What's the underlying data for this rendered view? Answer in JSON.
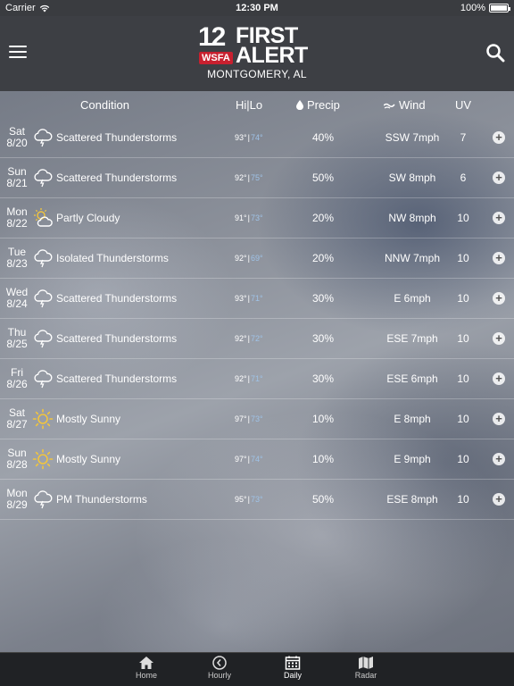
{
  "status_bar": {
    "carrier": "Carrier",
    "time": "12:30 PM",
    "battery": "100%",
    "battery_level": 1.0
  },
  "header": {
    "logo_number": "12",
    "logo_station": "WSFA",
    "logo_line1": "FIRST",
    "logo_line2": "ALERT",
    "location": "MONTGOMERY, AL",
    "menu_icon": "hamburger-menu-icon",
    "search_icon": "search-icon"
  },
  "columns": {
    "condition": "Condition",
    "hilo": "Hi|Lo",
    "precip": "Precip",
    "wind": "Wind",
    "uv": "UV"
  },
  "colors": {
    "lo_temp": "#9fc3e8",
    "sun": "#f2c53d",
    "header_bg": "#3d3f44",
    "tabbar_bg": "#202225"
  },
  "forecast": [
    {
      "dow": "Sat",
      "date": "8/20",
      "icon": "thunderstorm-icon",
      "condition": "Scattered Thunderstorms",
      "hi": "93°",
      "lo": "74°",
      "precip": "40%",
      "wind": "SSW 7mph",
      "uv": "7"
    },
    {
      "dow": "Sun",
      "date": "8/21",
      "icon": "thunderstorm-icon",
      "condition": "Scattered Thunderstorms",
      "hi": "92°",
      "lo": "75°",
      "precip": "50%",
      "wind": "SW 8mph",
      "uv": "6"
    },
    {
      "dow": "Mon",
      "date": "8/22",
      "icon": "partly-cloudy-icon",
      "condition": "Partly Cloudy",
      "hi": "91°",
      "lo": "73°",
      "precip": "20%",
      "wind": "NW 8mph",
      "uv": "10"
    },
    {
      "dow": "Tue",
      "date": "8/23",
      "icon": "thunderstorm-icon",
      "condition": "Isolated Thunderstorms",
      "hi": "92°",
      "lo": "69°",
      "precip": "20%",
      "wind": "NNW 7mph",
      "uv": "10"
    },
    {
      "dow": "Wed",
      "date": "8/24",
      "icon": "thunderstorm-icon",
      "condition": "Scattered Thunderstorms",
      "hi": "93°",
      "lo": "71°",
      "precip": "30%",
      "wind": "E 6mph",
      "uv": "10"
    },
    {
      "dow": "Thu",
      "date": "8/25",
      "icon": "thunderstorm-icon",
      "condition": "Scattered Thunderstorms",
      "hi": "92°",
      "lo": "72°",
      "precip": "30%",
      "wind": "ESE 7mph",
      "uv": "10"
    },
    {
      "dow": "Fri",
      "date": "8/26",
      "icon": "thunderstorm-icon",
      "condition": "Scattered Thunderstorms",
      "hi": "92°",
      "lo": "71°",
      "precip": "30%",
      "wind": "ESE 6mph",
      "uv": "10"
    },
    {
      "dow": "Sat",
      "date": "8/27",
      "icon": "sun-icon",
      "condition": "Mostly Sunny",
      "hi": "97°",
      "lo": "73°",
      "precip": "10%",
      "wind": "E 8mph",
      "uv": "10"
    },
    {
      "dow": "Sun",
      "date": "8/28",
      "icon": "sun-icon",
      "condition": "Mostly Sunny",
      "hi": "97°",
      "lo": "74°",
      "precip": "10%",
      "wind": "E 9mph",
      "uv": "10"
    },
    {
      "dow": "Mon",
      "date": "8/29",
      "icon": "thunderstorm-icon",
      "condition": "PM Thunderstorms",
      "hi": "95°",
      "lo": "73°",
      "precip": "50%",
      "wind": "ESE 8mph",
      "uv": "10"
    }
  ],
  "tabs": [
    {
      "label": "Home",
      "icon": "home-icon",
      "active": false
    },
    {
      "label": "Hourly",
      "icon": "clock-icon",
      "active": false
    },
    {
      "label": "Daily",
      "icon": "calendar-icon",
      "active": true
    },
    {
      "label": "Radar",
      "icon": "map-icon",
      "active": false
    }
  ]
}
